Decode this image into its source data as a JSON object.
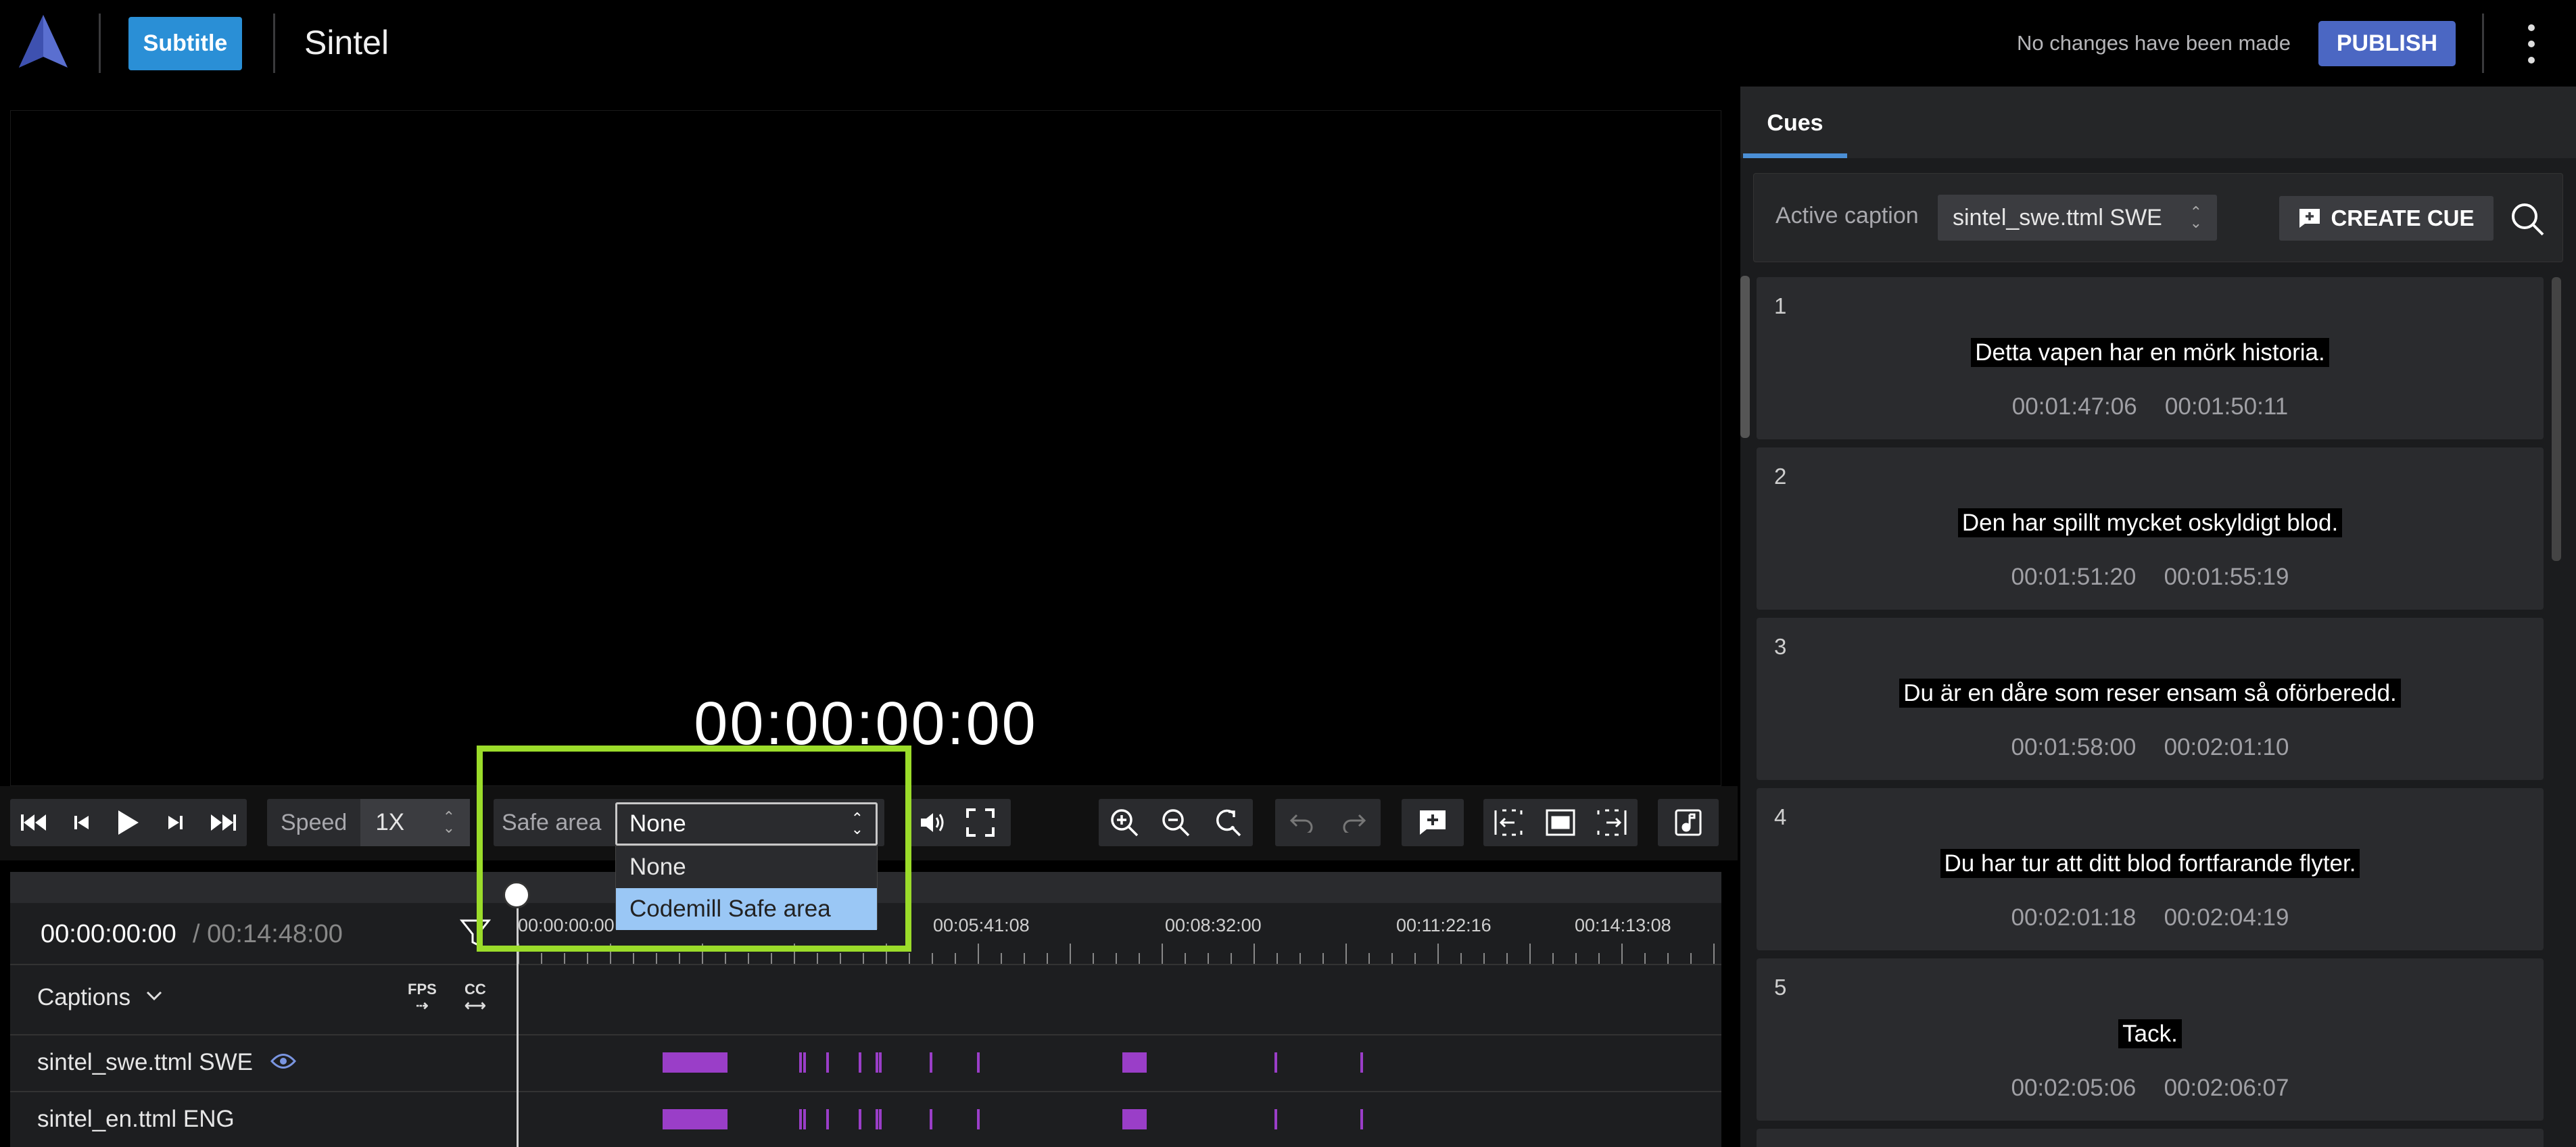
{
  "header": {
    "app_badge": "Subtitle",
    "title": "Sintel",
    "status": "No changes have been made",
    "publish_label": "PUBLISH"
  },
  "player": {
    "timecode": "00:00:00:00",
    "speed_label": "Speed",
    "speed_value": "1X",
    "safe_area_label": "Safe area",
    "safe_area_value": "None",
    "safe_area_options": [
      "None",
      "Codemill Safe area"
    ],
    "safe_area_highlighted": "Codemill Safe area"
  },
  "timeline": {
    "current_time": "00:00:00:00",
    "total_time": "/ 00:14:48:00",
    "ruler_labels": [
      "00:00:00:00",
      "00:05:41:08",
      "00:08:32:00",
      "00:11:22:16",
      "00:14:13:08"
    ],
    "group_label": "Captions",
    "fps_label": "FPS",
    "cc_label": "CC",
    "tracks": [
      {
        "name": "sintel_swe.ttml SWE",
        "visible_icon": "eye-icon"
      },
      {
        "name": "sintel_en.ttml ENG"
      }
    ]
  },
  "panel": {
    "tab": "Cues",
    "active_caption_label": "Active caption",
    "active_caption_value": "sintel_swe.ttml SWE",
    "create_cue_label": "CREATE CUE",
    "cues": [
      {
        "num": "1",
        "text": "Detta vapen har en mörk historia.",
        "start": "00:01:47:06",
        "end": "00:01:50:11"
      },
      {
        "num": "2",
        "text": "Den har spillt mycket oskyldigt blod.",
        "start": "00:01:51:20",
        "end": "00:01:55:19"
      },
      {
        "num": "3",
        "text": "Du är en dåre som reser ensam så oförberedd.",
        "start": "00:01:58:00",
        "end": "00:02:01:10"
      },
      {
        "num": "4",
        "text": "Du har tur att ditt blod fortfarande flyter.",
        "start": "00:02:01:18",
        "end": "00:02:04:19"
      },
      {
        "num": "5",
        "text": "Tack.",
        "start": "00:02:05:06",
        "end": "00:02:06:07"
      }
    ]
  },
  "colors": {
    "accent_blue": "#4b67c3",
    "badge_blue": "#2a8fd6",
    "highlight_green": "#9bdc2a",
    "caption_purple": "#9a3ec8"
  }
}
